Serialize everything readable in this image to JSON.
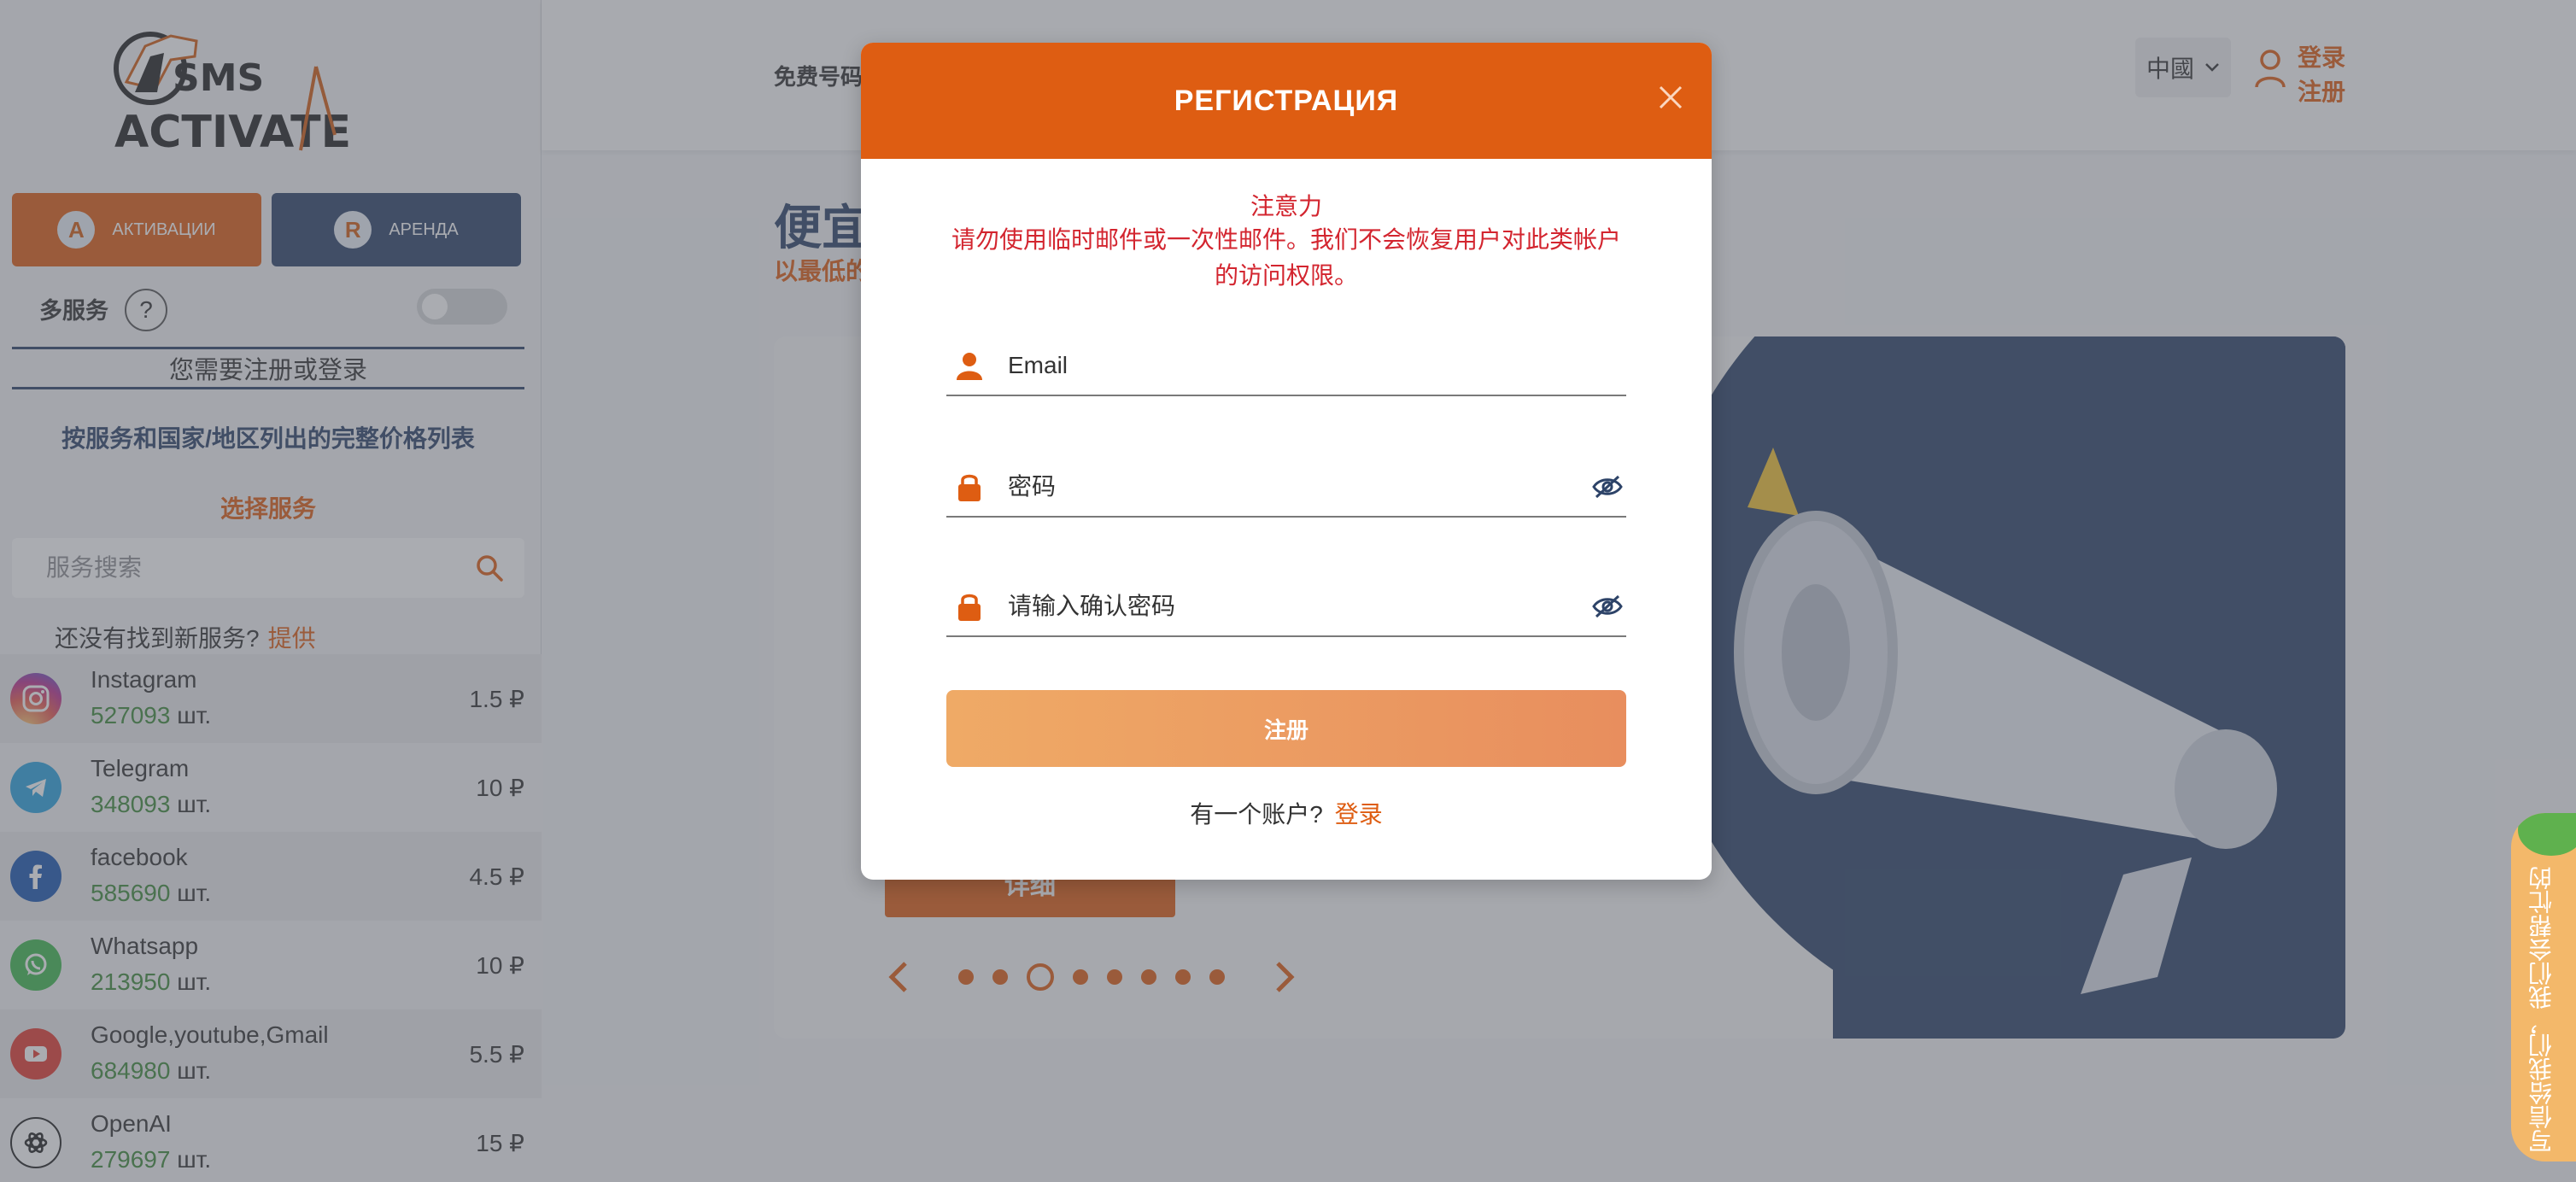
{
  "sidebar": {
    "logo_text_top": "SMS",
    "logo_text_bottom": "ACTIVATE",
    "mode_activations": "АКТИВАЦИИ",
    "mode_rent": "АРЕНДА",
    "multi_service_label": "多服务",
    "help_glyph": "?",
    "need_login": "您需要注册或登录",
    "full_price_list": "按服务和国家/地区列出的完整价格列表",
    "choose_service": "选择服务",
    "search_placeholder": "服务搜索",
    "not_found_text": "还没有找到新服务?",
    "offer_link": "提供",
    "services": [
      {
        "name": "Instagram",
        "count": "527093",
        "unit": "шт.",
        "price": "1.5 ₽",
        "icon": "instagram-icon"
      },
      {
        "name": "Telegram",
        "count": "348093",
        "unit": "шт.",
        "price": "10 ₽",
        "icon": "telegram-icon"
      },
      {
        "name": "facebook",
        "count": "585690",
        "unit": "шт.",
        "price": "4.5 ₽",
        "icon": "facebook-icon"
      },
      {
        "name": "Whatsapp",
        "count": "213950",
        "unit": "шт.",
        "price": "10 ₽",
        "icon": "whatsapp-icon"
      },
      {
        "name": "Google,youtube,Gmail",
        "count": "684980",
        "unit": "шт.",
        "price": "5.5 ₽",
        "icon": "youtube-icon"
      },
      {
        "name": "OpenAI",
        "count": "279697",
        "unit": "шт.",
        "price": "15 ₽",
        "icon": "openai-icon"
      }
    ]
  },
  "header": {
    "free_numbers": "免费号码",
    "language": "中國",
    "login": "登录",
    "register": "注册"
  },
  "main": {
    "hero_title": "便宜",
    "hero_subtitle": "以最低的",
    "details_button": "详细",
    "carousel_dots": 8,
    "carousel_active": 3
  },
  "feedback": {
    "text": "写信给我们，我们会帮忙的"
  },
  "modal": {
    "title": "РЕГИСТРАЦИЯ",
    "warning_title": "注意力",
    "warning_text": "请勿使用临时邮件或一次性邮件。我们不会恢复用户对此类帐户的访问权限。",
    "email_placeholder": "Email",
    "password_placeholder": "密码",
    "confirm_placeholder": "请输入确认密码",
    "submit_label": "注册",
    "have_account": "有一个账户?",
    "login_link": "登录"
  },
  "colors": {
    "accent": "#de5d12",
    "navy": "#2d4368",
    "warning": "#d3252f",
    "count_green": "#3e8a3a"
  }
}
